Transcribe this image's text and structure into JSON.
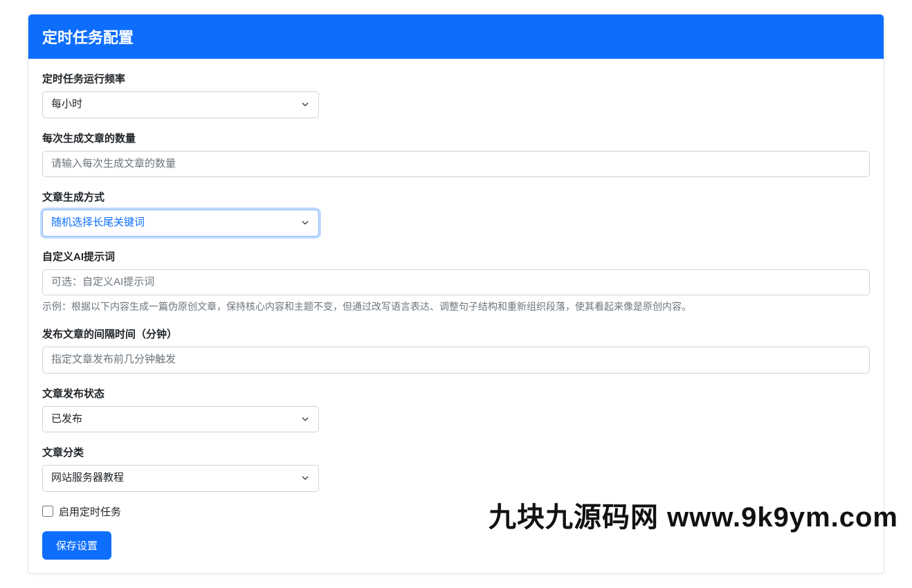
{
  "header": {
    "title": "定时任务配置"
  },
  "form": {
    "frequency": {
      "label": "定时任务运行频率",
      "value": "每小时"
    },
    "articleCount": {
      "label": "每次生成文章的数量",
      "placeholder": "请输入每次生成文章的数量"
    },
    "generateMethod": {
      "label": "文章生成方式",
      "value": "随机选择长尾关键词"
    },
    "aiPrompt": {
      "label": "自定义AI提示词",
      "placeholder": "可选：自定义AI提示词",
      "help": "示例：根据以下内容生成一篇伪原创文章，保持核心内容和主题不变，但通过改写语言表达、调整句子结构和重新组织段落，使其看起来像是原创内容。"
    },
    "interval": {
      "label": "发布文章的间隔时间（分钟）",
      "placeholder": "指定文章发布前几分钟触发"
    },
    "publishStatus": {
      "label": "文章发布状态",
      "value": "已发布"
    },
    "category": {
      "label": "文章分类",
      "value": "网站服务器教程"
    },
    "enableTask": {
      "label": "启用定时任务"
    },
    "submit": {
      "label": "保存设置"
    }
  },
  "watermark": "九块九源码网 www.9k9ym.com"
}
